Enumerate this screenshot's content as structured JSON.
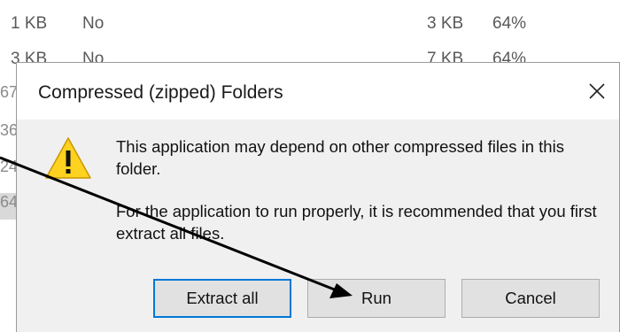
{
  "background_list": {
    "rows": [
      {
        "size": "1 KB",
        "encrypted": "No",
        "compressed_size": "3 KB",
        "ratio": "64%"
      },
      {
        "size": "3 KB",
        "encrypted": "No",
        "compressed_size": "7 KB",
        "ratio": "64%"
      }
    ],
    "fragments": [
      "67",
      "36",
      "24",
      "64"
    ]
  },
  "dialog": {
    "title": "Compressed (zipped) Folders",
    "close_glyph": "✕",
    "icon": "warning-icon",
    "message_line_1": "This application may depend on other compressed files in this folder.",
    "message_line_2": "For the application to run properly, it is recommended that you first extract all files.",
    "buttons": {
      "extract_all": "Extract all",
      "run": "Run",
      "cancel": "Cancel"
    }
  },
  "annotation": {
    "type": "arrow",
    "points_to": "run-button",
    "color": "#000000"
  },
  "colors": {
    "dialog_bg": "#f0f0f0",
    "focus_border": "#0078d7",
    "warning_fill": "#ffd21f"
  }
}
